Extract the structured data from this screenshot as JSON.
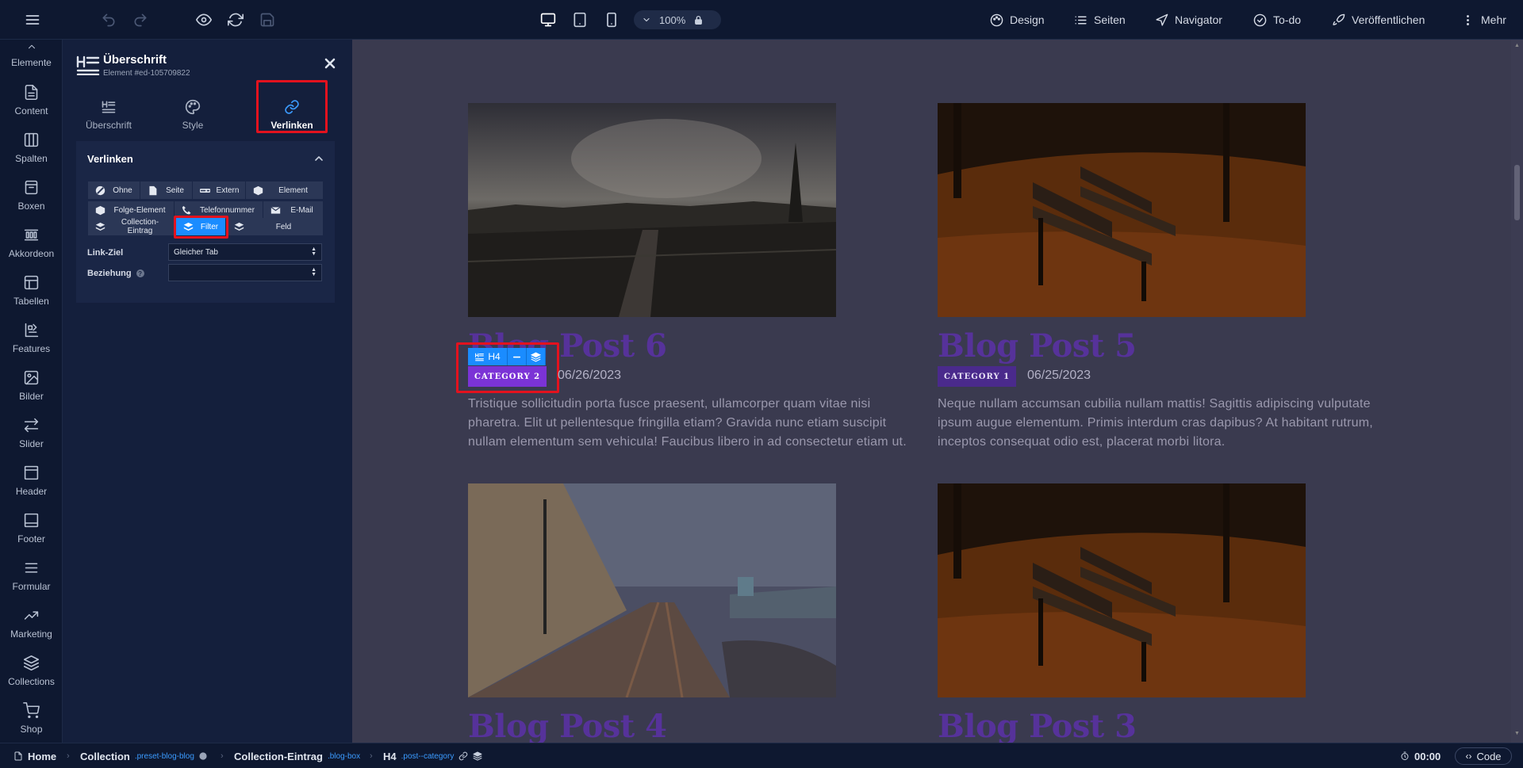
{
  "toolbar": {
    "zoom": "100%",
    "nav": [
      "Design",
      "Seiten",
      "Navigator",
      "To-do",
      "Veröffentlichen",
      "Mehr"
    ]
  },
  "sidebar": {
    "items": [
      {
        "label": "Elemente",
        "icon": "chevron-up-icon"
      },
      {
        "label": "Content",
        "icon": "document-icon"
      },
      {
        "label": "Spalten",
        "icon": "columns-icon"
      },
      {
        "label": "Boxen",
        "icon": "box-icon"
      },
      {
        "label": "Akkordeon",
        "icon": "accordion-icon"
      },
      {
        "label": "Tabellen",
        "icon": "table-icon"
      },
      {
        "label": "Features",
        "icon": "features-icon"
      },
      {
        "label": "Bilder",
        "icon": "image-icon"
      },
      {
        "label": "Slider",
        "icon": "slider-arrows-icon"
      },
      {
        "label": "Header",
        "icon": "header-icon"
      },
      {
        "label": "Footer",
        "icon": "footer-icon"
      },
      {
        "label": "Formular",
        "icon": "form-lines-icon"
      },
      {
        "label": "Marketing",
        "icon": "trend-up-icon"
      },
      {
        "label": "Collections",
        "icon": "layers-icon"
      },
      {
        "label": "Shop",
        "icon": "cart-icon"
      }
    ]
  },
  "panel": {
    "title": "Überschrift",
    "subtitle": "Element #ed-105709822",
    "tabs": [
      "Überschrift",
      "Style",
      "Verlinken"
    ],
    "active_tab": "Verlinken",
    "section_title": "Verlinken",
    "link_types": [
      "Ohne",
      "Seite",
      "Extern",
      "Element",
      "Folge-Element",
      "Telefonnummer",
      "E-Mail",
      "Collection-Eintrag",
      "Filter",
      "Feld"
    ],
    "active_link_type": "Filter",
    "link_target_label": "Link-Ziel",
    "link_target_value": "Gleicher Tab",
    "relation_label": "Beziehung",
    "relation_value": ""
  },
  "canvas": {
    "posts": [
      {
        "title": "Blog Post 6",
        "category": "CATEGORY 2",
        "date": "06/26/2023",
        "text": "Tristique sollicitudin porta fusce praesent, ullamcorper quam vitae nisi pharetra. Elit ut pellentesque fringilla etiam? Gravida nunc etiam suscipit nullam elementum sem vehicula! Faucibus libero in ad consectetur etiam ut.",
        "image": "paris-skyline"
      },
      {
        "title": "Blog Post 5",
        "category": "CATEGORY 1",
        "date": "06/25/2023",
        "text": "Neque nullam accumsan cubilia nullam mattis! Sagittis adipiscing vulputate ipsum augue elementum. Primis interdum cras dapibus? At habitant rutrum, inceptos consequat odio est, placerat morbi litora.",
        "image": "autumn-park-benches"
      },
      {
        "title": "Blog Post 4",
        "image": "coastal-railway"
      },
      {
        "title": "Blog Post 3",
        "image": "autumn-park-benches"
      }
    ],
    "selection_toolbar": {
      "tag": "H4"
    }
  },
  "bottombar": {
    "crumbs": [
      {
        "label": "Home",
        "cls": ""
      },
      {
        "label": "Collection",
        "cls": ".preset-blog-blog"
      },
      {
        "label": "Collection-Eintrag",
        "cls": ".blog-box"
      },
      {
        "label": "H4",
        "cls": ".post--category"
      }
    ],
    "time": "00:00",
    "code_label": "Code"
  },
  "colors": {
    "accent": "#1a8cff",
    "highlight": "#e3121e",
    "heading": "#56329a",
    "badge": "#4a2a8c"
  }
}
